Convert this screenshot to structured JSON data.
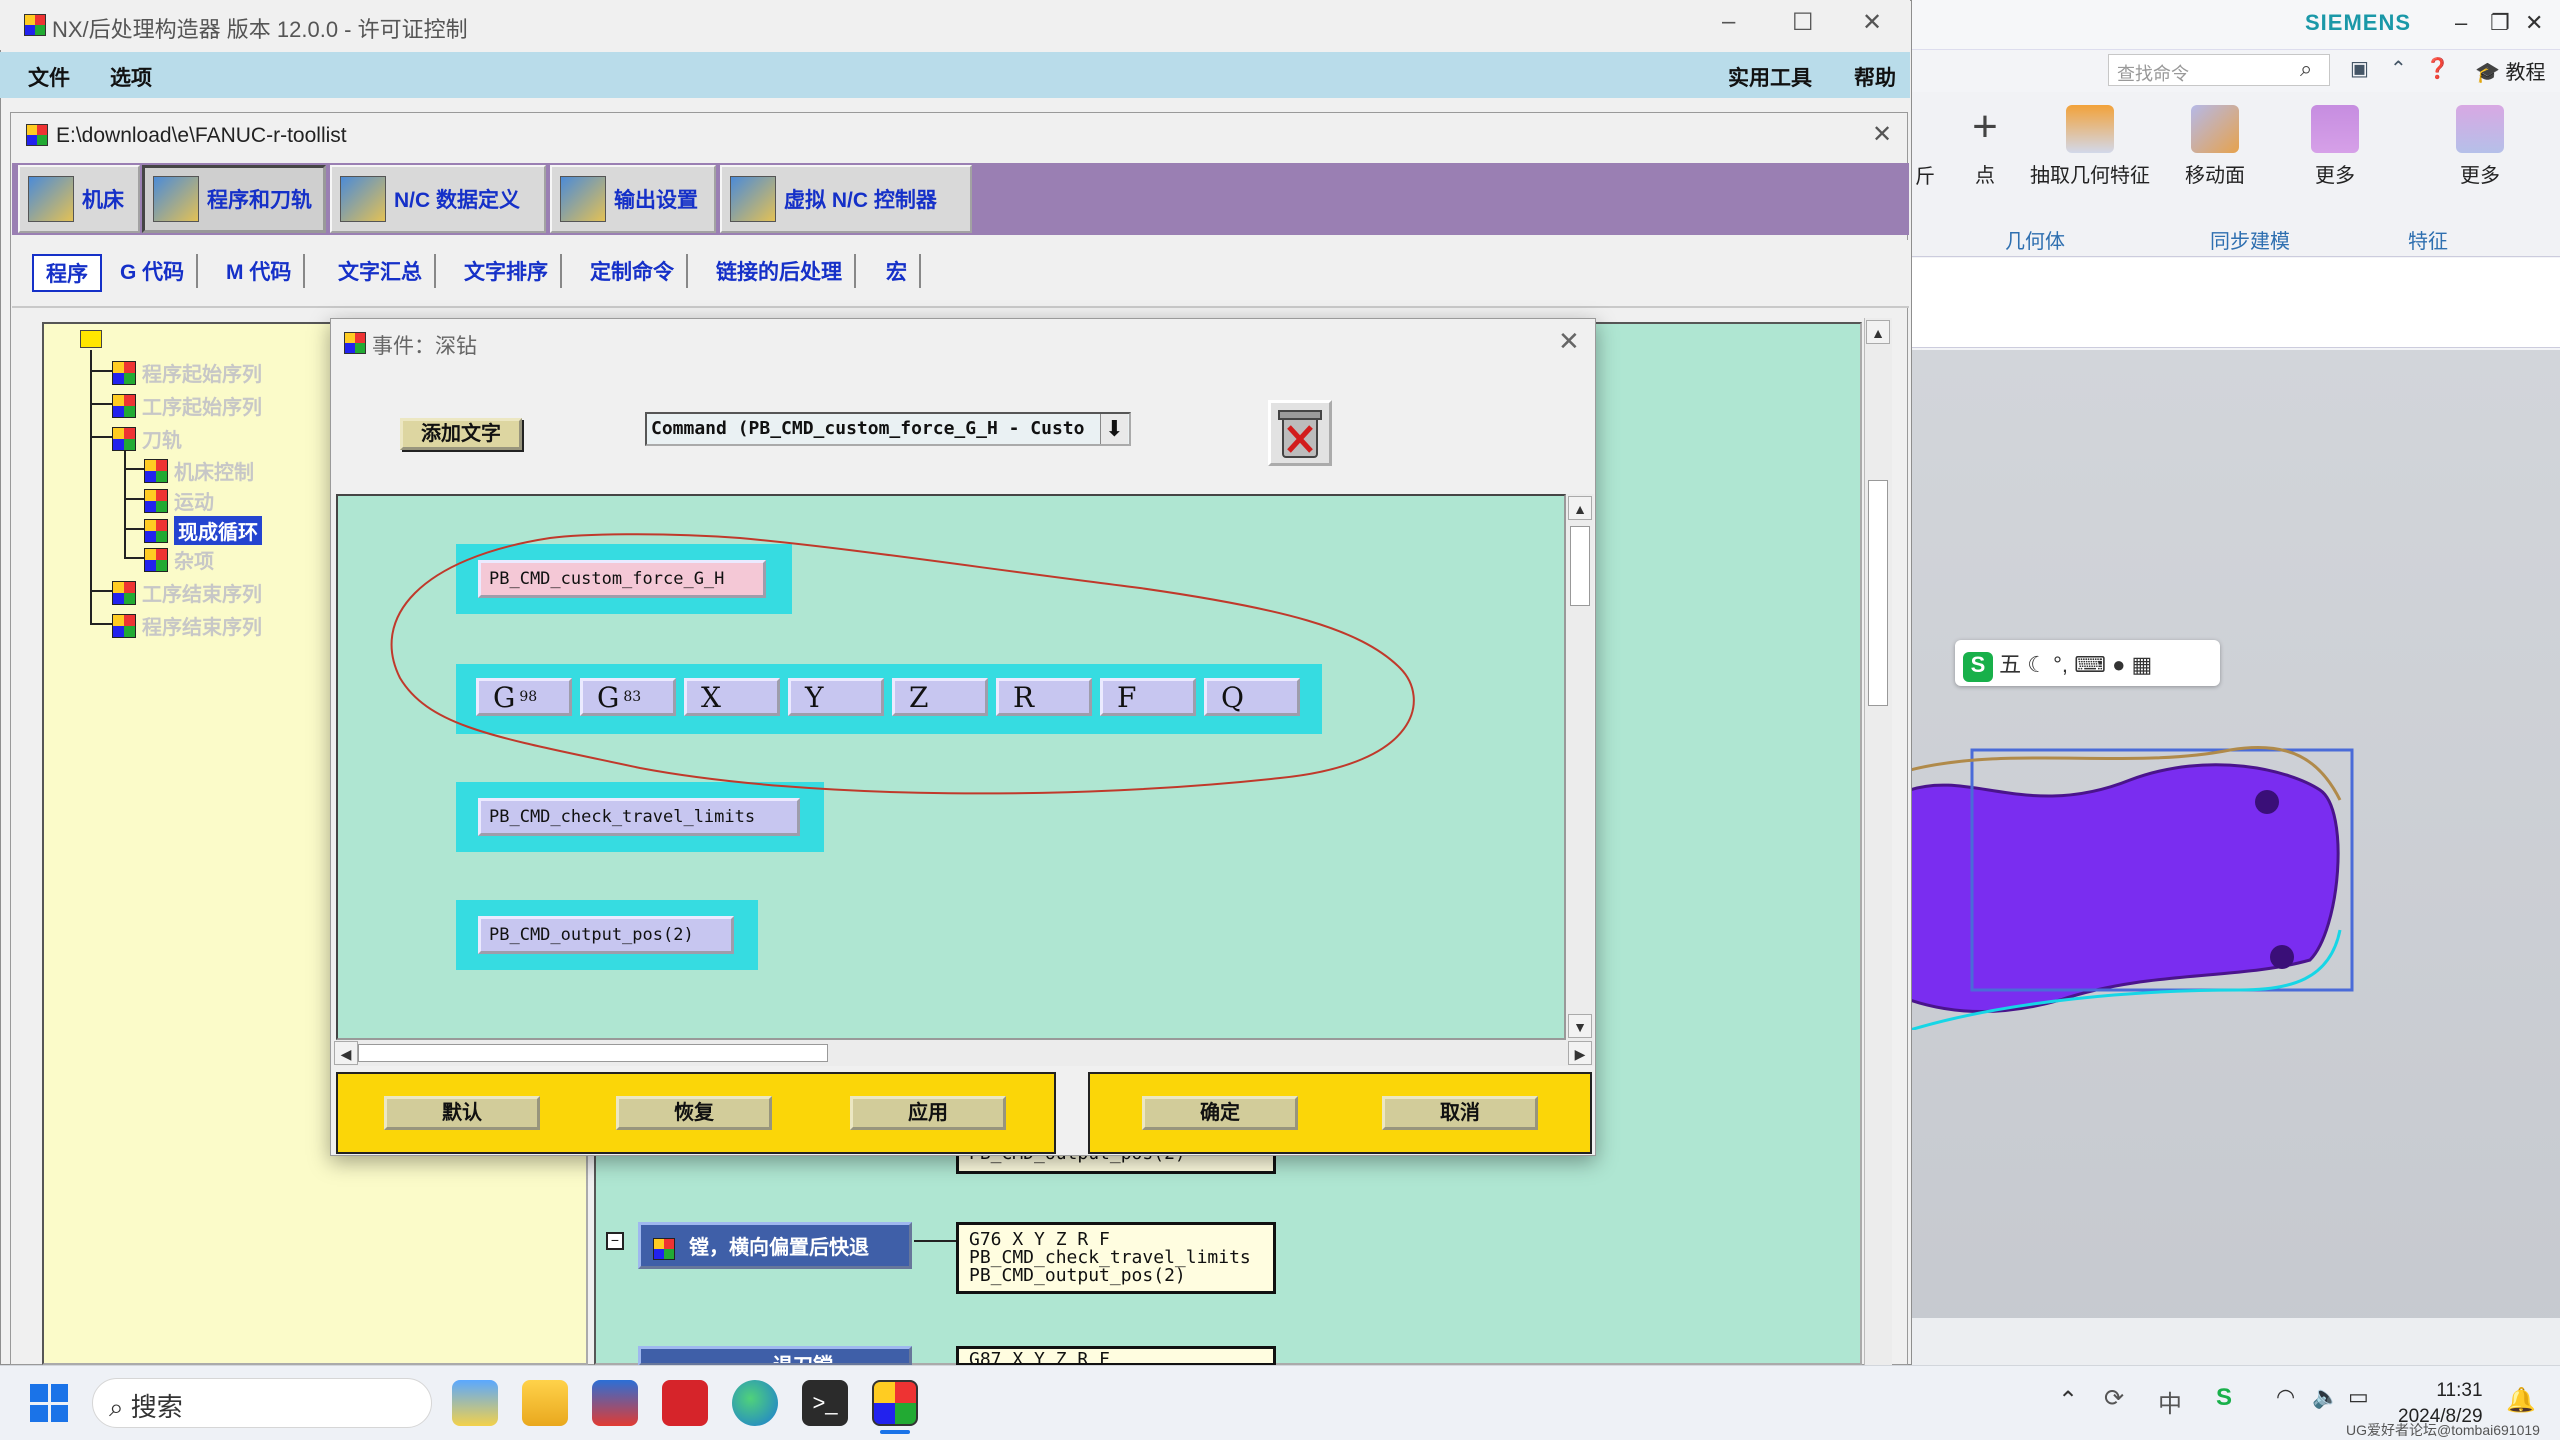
{
  "nx_window": {
    "brand": "SIEMENS",
    "search_placeholder": "查找命令",
    "tutorial": "教程",
    "ribbon": {
      "cut_label": "斤",
      "point": "点",
      "extract": "抽取几何特征",
      "move_face": "移动面",
      "more1": "更多",
      "more2": "更多",
      "group_geometry": "几何体",
      "group_sync": "同步建模",
      "group_feature": "特征"
    },
    "ime": "五"
  },
  "app": {
    "title": "NX/后处理构造器 版本 12.0.0 - 许可证控制",
    "menus": {
      "file": "文件",
      "options": "选项",
      "utilities": "实用工具",
      "help": "帮助"
    }
  },
  "subwindow": {
    "title": "E:\\download\\e\\FANUC-r-toollist",
    "main_tabs": [
      "机床",
      "程序和刀轨",
      "N/C 数据定义",
      "输出设置",
      "虚拟 N/C 控制器"
    ],
    "sub_tabs": [
      "程序",
      "G 代码",
      "M 代码",
      "文字汇总",
      "文字排序",
      "定制命令",
      "链接的后处理",
      "宏"
    ]
  },
  "tree": {
    "items": [
      {
        "label": "程序起始序列",
        "level": 1,
        "selected": false
      },
      {
        "label": "工序起始序列",
        "level": 1,
        "selected": false
      },
      {
        "label": "刀轨",
        "level": 1,
        "selected": false
      },
      {
        "label": "机床控制",
        "level": 2,
        "selected": false
      },
      {
        "label": "运动",
        "level": 2,
        "selected": false
      },
      {
        "label": "现成循环",
        "level": 2,
        "selected": true
      },
      {
        "label": "杂项",
        "level": 2,
        "selected": false
      },
      {
        "label": "工序结束序列",
        "level": 1,
        "selected": false
      },
      {
        "label": "程序结束序列",
        "level": 1,
        "selected": false
      }
    ]
  },
  "canvas_events": {
    "partial_code": "PB_CMD_output_pos(2)",
    "event1": {
      "label": "镗，横向偏置后快退",
      "code": [
        "G76 X Y Z R F",
        "PB_CMD_check_travel_limits",
        "PB_CMD_output_pos(2)"
      ]
    },
    "event2": {
      "label": "退刀镗",
      "code": [
        "G87 X Y Z R F"
      ]
    }
  },
  "dialog": {
    "title": "事件：深钻",
    "add_text": "添加文字",
    "command_select": "Command (PB_CMD_custom_force_G_H - Custo",
    "blocks": {
      "cmd1": "PB_CMD_custom_force_G_H",
      "addresses": [
        {
          "letter": "G",
          "sub": "98"
        },
        {
          "letter": "G",
          "sub": "83"
        },
        {
          "letter": "X",
          "sub": ""
        },
        {
          "letter": "Y",
          "sub": ""
        },
        {
          "letter": "Z",
          "sub": ""
        },
        {
          "letter": "R",
          "sub": ""
        },
        {
          "letter": "F",
          "sub": ""
        },
        {
          "letter": "Q",
          "sub": ""
        }
      ],
      "cmd2": "PB_CMD_check_travel_limits",
      "cmd3": "PB_CMD_output_pos(2)"
    },
    "buttons": {
      "default": "默认",
      "restore": "恢复",
      "apply": "应用",
      "ok": "确定",
      "cancel": "取消"
    }
  },
  "taskbar": {
    "search": "搜索",
    "time": "11:31",
    "date": "2024/8/29",
    "watermark": "UG爱好者论坛@tombai691019"
  },
  "colors": {
    "menubar": "#b9dcea",
    "tab_strip": "#9a7fb3",
    "canvas_teal": "#afe6d2",
    "block_cyan": "#36dce1",
    "button_lavender": "#c7c6f0",
    "bottom_yellow": "#fbd608",
    "annotation_red": "#c0392b"
  }
}
